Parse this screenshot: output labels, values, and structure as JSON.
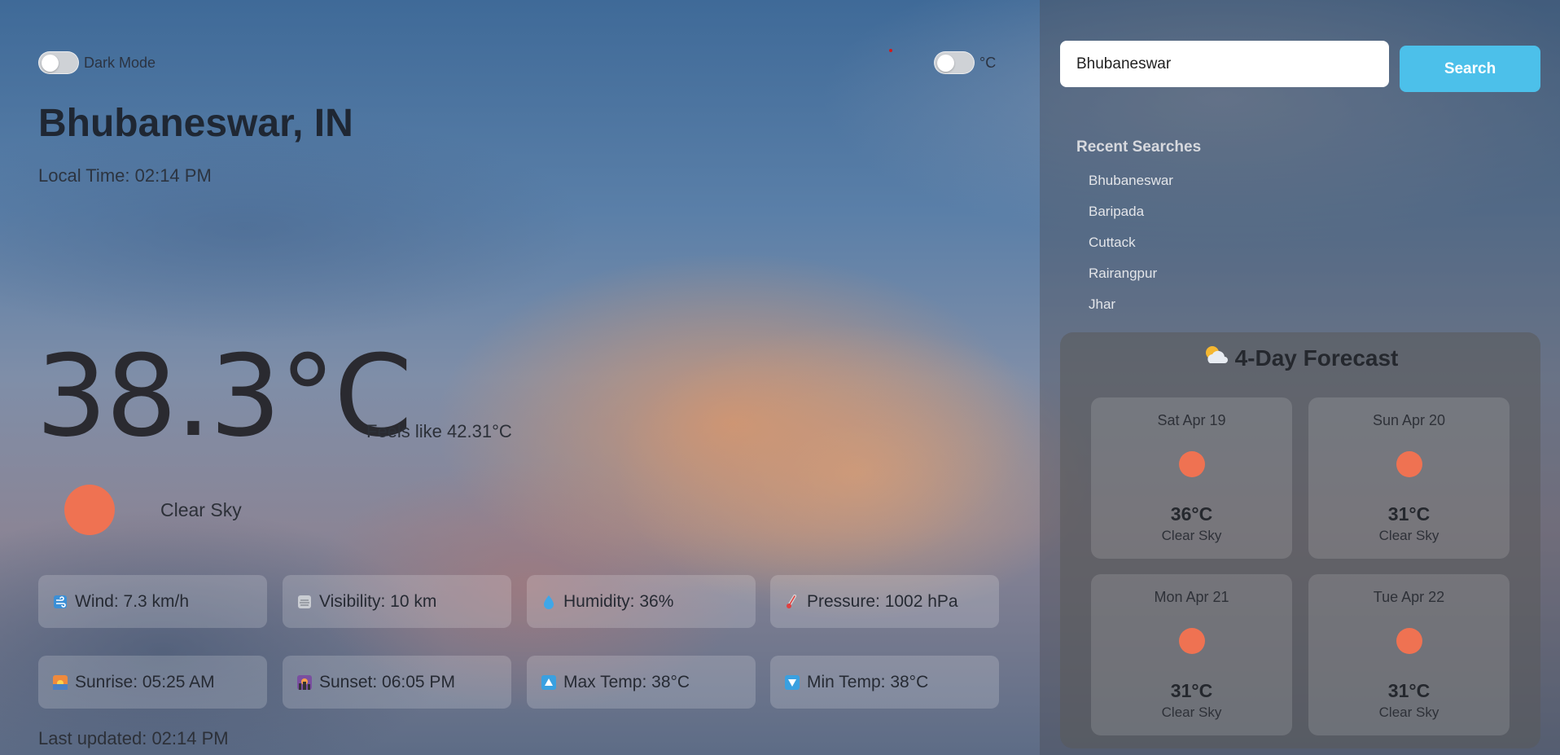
{
  "toggles": {
    "dark_mode_label": "Dark Mode",
    "unit_label": "°C"
  },
  "location": {
    "city": "Bhubaneswar, IN",
    "local_time": "Local Time: 02:14 PM"
  },
  "current": {
    "temperature": "38.3°C",
    "feels_like": "Feels like 42.31°C",
    "condition": "Clear Sky",
    "condition_icon": "sun-icon",
    "condition_color": "#ef7252"
  },
  "details": [
    {
      "icon": "wind-icon",
      "text": "Wind: 7.3 km/h"
    },
    {
      "icon": "fog-icon",
      "text": "Visibility: 10 km"
    },
    {
      "icon": "droplet-icon",
      "text": "Humidity: 36%"
    },
    {
      "icon": "thermometer-icon",
      "text": "Pressure: 1002 hPa"
    },
    {
      "icon": "sunrise-icon",
      "text": "Sunrise: 05:25 AM"
    },
    {
      "icon": "sunset-icon",
      "text": "Sunset: 06:05 PM"
    },
    {
      "icon": "arrow-up-icon",
      "text": "Max Temp: 38°C"
    },
    {
      "icon": "arrow-down-icon",
      "text": "Min Temp: 38°C"
    }
  ],
  "last_updated": "Last updated: 02:14 PM",
  "search": {
    "value": "Bhubaneswar",
    "button_label": "Search",
    "button_color": "#4cc0ea"
  },
  "recent": {
    "title": "Recent Searches",
    "items": [
      "Bhubaneswar",
      "Baripada",
      "Cuttack",
      "Rairangpur",
      "Jhar"
    ]
  },
  "forecast": {
    "title": "4-Day Forecast",
    "title_icon": "sun-behind-cloud-icon",
    "days": [
      {
        "date": "Sat Apr 19",
        "temp": "36°C",
        "desc": "Clear Sky"
      },
      {
        "date": "Sun Apr 20",
        "temp": "31°C",
        "desc": "Clear Sky"
      },
      {
        "date": "Mon Apr 21",
        "temp": "31°C",
        "desc": "Clear Sky"
      },
      {
        "date": "Tue Apr 22",
        "temp": "31°C",
        "desc": "Clear Sky"
      }
    ]
  }
}
